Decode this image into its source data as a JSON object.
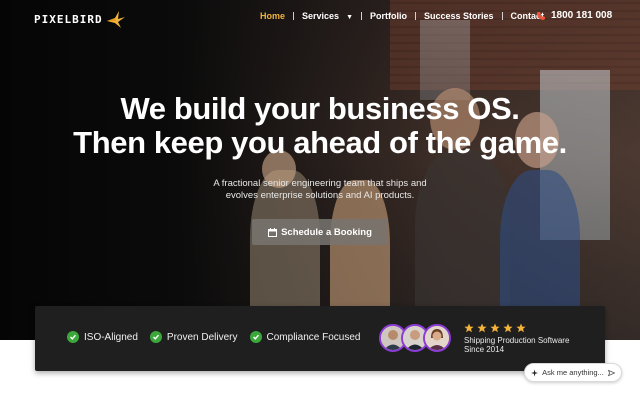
{
  "brand": {
    "name": "PIXELBIRD",
    "logo_icon": "bird-icon",
    "accent": "#f2b33a"
  },
  "nav": {
    "items": [
      {
        "label": "Home",
        "active": true
      },
      {
        "label": "Services",
        "has_dropdown": true
      },
      {
        "label": "Portfolio"
      },
      {
        "label": "Success Stories"
      },
      {
        "label": "Contact"
      }
    ],
    "phone": "1800 181 008",
    "phone_icon": "phone-icon",
    "phone_icon_color": "#e8563a"
  },
  "hero": {
    "headline_line1": "We build your business OS.",
    "headline_line2": "Then keep you ahead of the game.",
    "subtext_line1": "A fractional senior engineering team that ships and",
    "subtext_line2": "evolves enterprise solutions and AI products.",
    "cta_label": "Schedule a Booking",
    "cta_icon": "calendar-icon"
  },
  "trust": {
    "badges": [
      {
        "label": "ISO-Aligned",
        "icon": "check-circle-icon"
      },
      {
        "label": "Proven Delivery",
        "icon": "check-circle-icon"
      },
      {
        "label": "Compliance Focused",
        "icon": "check-circle-icon"
      }
    ],
    "badge_color": "#3ca83c",
    "avatar_count": 3,
    "rating_stars": 5,
    "star_color": "#f2b33a",
    "tagline_line1": "Shipping Production Software",
    "tagline_line2": "Since 2014"
  },
  "assistant": {
    "placeholder": "Ask me anything...",
    "icon": "sparkle-icon",
    "send_icon": "send-icon"
  }
}
